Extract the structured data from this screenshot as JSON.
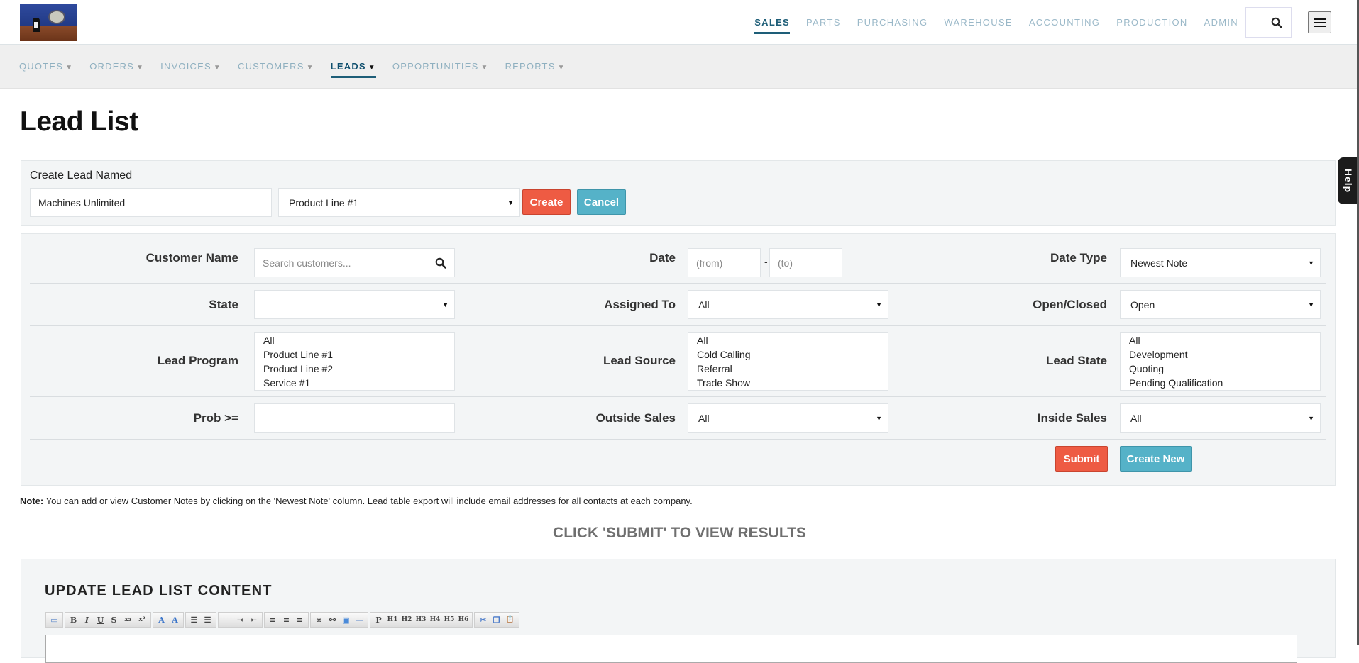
{
  "header": {
    "logo_alt": "Company logo",
    "top_nav": [
      {
        "label": "SALES",
        "active": true
      },
      {
        "label": "PARTS",
        "active": false
      },
      {
        "label": "PURCHASING",
        "active": false
      },
      {
        "label": "WAREHOUSE",
        "active": false
      },
      {
        "label": "ACCOUNTING",
        "active": false
      },
      {
        "label": "PRODUCTION",
        "active": false
      },
      {
        "label": "ADMIN",
        "active": false
      }
    ],
    "search_icon": "search-icon",
    "menu_icon": "hamburger-menu-icon"
  },
  "sub_nav": [
    {
      "label": "QUOTES",
      "active": false
    },
    {
      "label": "ORDERS",
      "active": false
    },
    {
      "label": "INVOICES",
      "active": false
    },
    {
      "label": "CUSTOMERS",
      "active": false
    },
    {
      "label": "LEADS",
      "active": true
    },
    {
      "label": "OPPORTUNITIES",
      "active": false
    },
    {
      "label": "REPORTS",
      "active": false
    }
  ],
  "caret": "▼",
  "page_title": "Lead List",
  "create_lead": {
    "label": "Create Lead Named",
    "name_value": "Machines Unlimited",
    "program_selected": "Product Line #1",
    "create_label": "Create",
    "cancel_label": "Cancel"
  },
  "filters": {
    "customer_name": {
      "label": "Customer Name",
      "placeholder": "Search customers..."
    },
    "date": {
      "label": "Date",
      "from_placeholder": "(from)",
      "to_placeholder": "(to)",
      "separator": "-"
    },
    "date_type": {
      "label": "Date Type",
      "selected": "Newest Note"
    },
    "state": {
      "label": "State",
      "selected": ""
    },
    "assigned_to": {
      "label": "Assigned To",
      "selected": "All"
    },
    "open_closed": {
      "label": "Open/Closed",
      "selected": "Open"
    },
    "lead_program": {
      "label": "Lead Program",
      "options": [
        "All",
        "Product Line #1",
        "Product Line #2",
        "Service #1"
      ]
    },
    "lead_source": {
      "label": "Lead Source",
      "options": [
        "All",
        "Cold Calling",
        "Referral",
        "Trade Show"
      ]
    },
    "lead_state": {
      "label": "Lead State",
      "options": [
        "All",
        "Development",
        "Quoting",
        "Pending Qualification"
      ]
    },
    "prob": {
      "label": "Prob >=",
      "value": ""
    },
    "outside_sales": {
      "label": "Outside Sales",
      "selected": "All"
    },
    "inside_sales": {
      "label": "Inside Sales",
      "selected": "All"
    },
    "submit_label": "Submit",
    "create_new_label": "Create New"
  },
  "note": {
    "prefix": "Note:",
    "text": " You can add or view Customer Notes by clicking on the 'Newest Note' column. Lead table export will include email addresses for all contacts at each company."
  },
  "results_message": "CLICK 'SUBMIT' TO VIEW RESULTS",
  "editor": {
    "title": "UPDATE LEAD LIST CONTENT",
    "toolbar_groups": [
      [
        {
          "name": "html-icon",
          "glyph": "▭"
        }
      ],
      [
        {
          "name": "bold-icon",
          "glyph": "B"
        },
        {
          "name": "italic-icon",
          "glyph": "I"
        },
        {
          "name": "underline-icon",
          "glyph": "U"
        },
        {
          "name": "strikethrough-icon",
          "glyph": "S"
        },
        {
          "name": "subscript-icon",
          "glyph": "x₂"
        },
        {
          "name": "superscript-icon",
          "glyph": "x²"
        }
      ],
      [
        {
          "name": "add-font-icon",
          "glyph": "A"
        },
        {
          "name": "remove-font-icon",
          "glyph": "A"
        }
      ],
      [
        {
          "name": "ordered-list-icon",
          "glyph": "☰"
        },
        {
          "name": "unordered-list-icon",
          "glyph": "☰"
        }
      ],
      [
        {
          "name": "blank-icon",
          "glyph": ""
        },
        {
          "name": "indent-icon",
          "glyph": "⇥"
        },
        {
          "name": "outdent-icon",
          "glyph": "⇤"
        }
      ],
      [
        {
          "name": "align-left-icon",
          "glyph": "≡"
        },
        {
          "name": "align-center-icon",
          "glyph": "≡"
        },
        {
          "name": "align-right-icon",
          "glyph": "≡"
        }
      ],
      [
        {
          "name": "link-icon",
          "glyph": "∞"
        },
        {
          "name": "unlink-icon",
          "glyph": "⚯"
        },
        {
          "name": "image-icon",
          "glyph": "▣"
        },
        {
          "name": "horizontal-rule-icon",
          "glyph": "—"
        }
      ],
      [
        {
          "name": "paragraph-icon",
          "glyph": "P"
        },
        {
          "name": "h1-icon",
          "glyph": "H1"
        },
        {
          "name": "h2-icon",
          "glyph": "H2"
        },
        {
          "name": "h3-icon",
          "glyph": "H3"
        },
        {
          "name": "h4-icon",
          "glyph": "H4"
        },
        {
          "name": "h5-icon",
          "glyph": "H5"
        },
        {
          "name": "h6-icon",
          "glyph": "H6"
        }
      ],
      [
        {
          "name": "cut-icon",
          "glyph": "✂"
        },
        {
          "name": "copy-icon",
          "glyph": "❐"
        },
        {
          "name": "paste-icon",
          "glyph": "📋"
        }
      ]
    ]
  },
  "help_tab": "Help",
  "colors": {
    "accent": "#1e5e78",
    "nav_inactive": "#9ab8c8",
    "btn_red": "#ee5b43",
    "btn_teal": "#55b2c8",
    "panel_bg": "#f3f5f6"
  }
}
